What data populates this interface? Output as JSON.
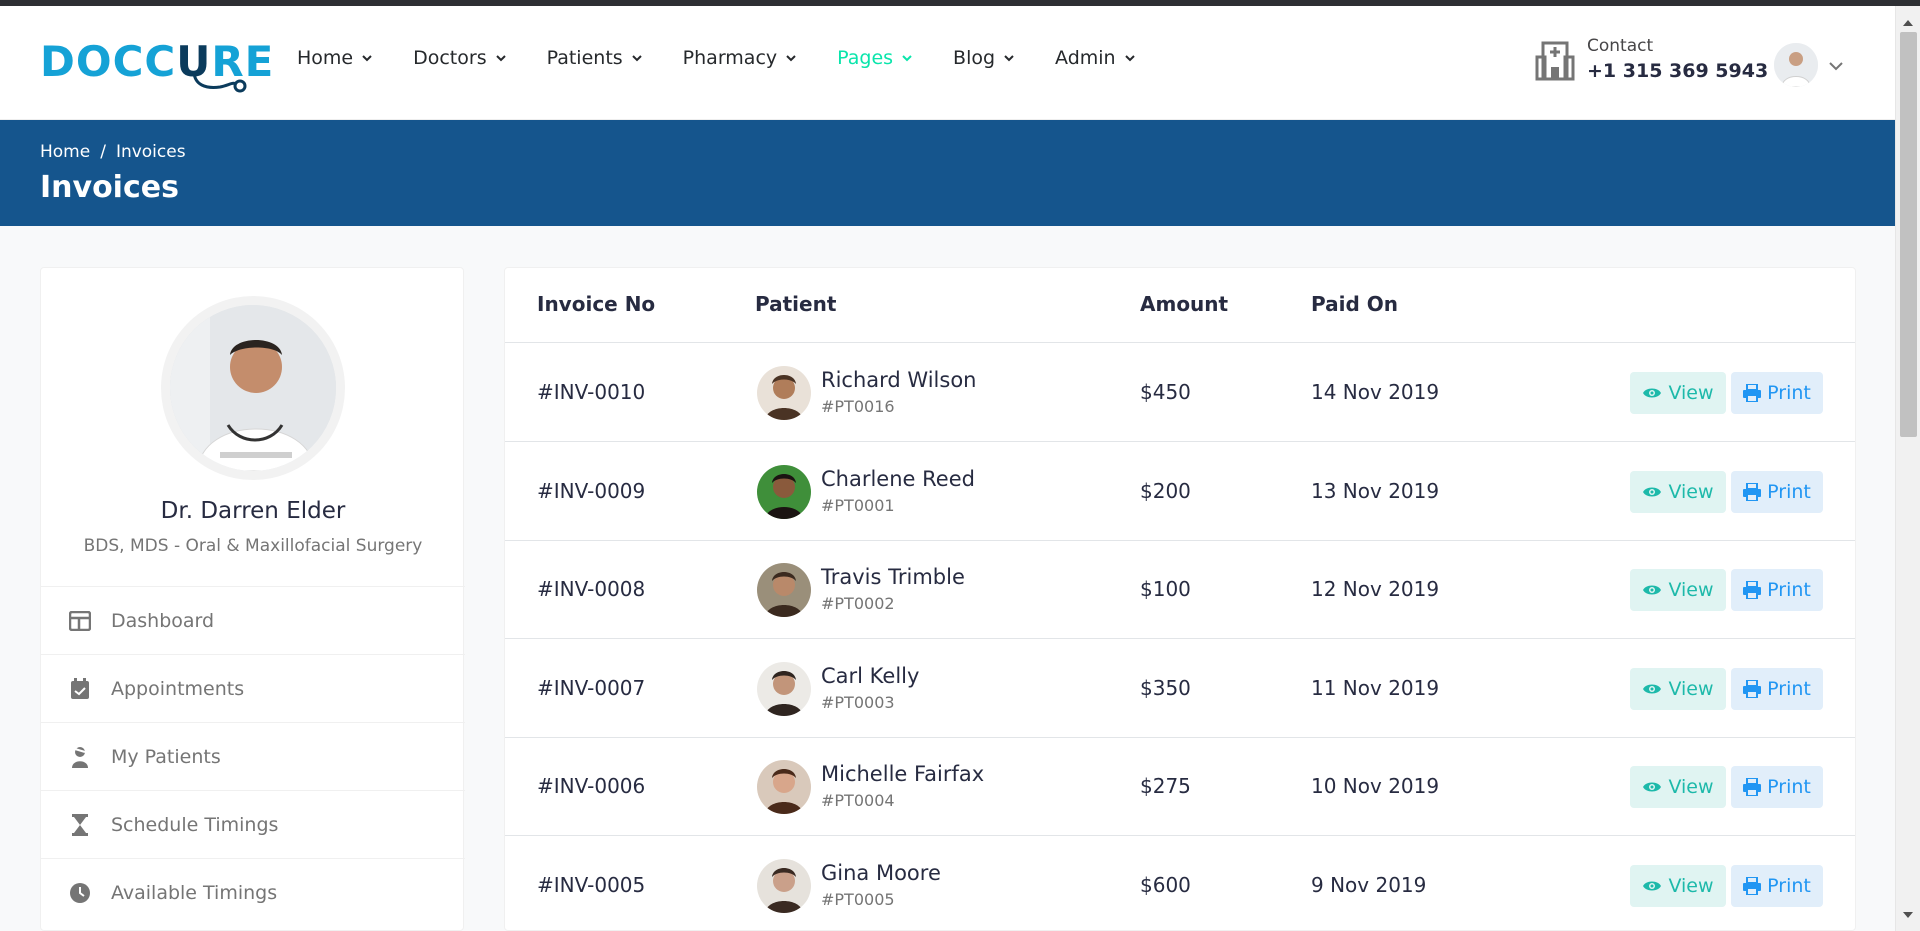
{
  "header": {
    "logo_text_a": "DOCC",
    "logo_text_u": "U",
    "logo_text_b": "RE",
    "nav": [
      {
        "label": "Home",
        "active": false
      },
      {
        "label": "Doctors",
        "active": false
      },
      {
        "label": "Patients",
        "active": false
      },
      {
        "label": "Pharmacy",
        "active": false
      },
      {
        "label": "Pages",
        "active": true
      },
      {
        "label": "Blog",
        "active": false
      },
      {
        "label": "Admin",
        "active": false
      }
    ],
    "contact_label": "Contact",
    "contact_phone": "+1 315 369 5943"
  },
  "breadcrumb": {
    "home": "Home",
    "separator": "/",
    "current": "Invoices",
    "title": "Invoices"
  },
  "sidebar": {
    "doctor_name": "Dr. Darren Elder",
    "doctor_specialty": "BDS, MDS - Oral & Maxillofacial Surgery",
    "menu": [
      {
        "label": "Dashboard",
        "icon": "dashboard-icon"
      },
      {
        "label": "Appointments",
        "icon": "calendar-check-icon"
      },
      {
        "label": "My Patients",
        "icon": "user-injured-icon"
      },
      {
        "label": "Schedule Timings",
        "icon": "hourglass-icon"
      },
      {
        "label": "Available Timings",
        "icon": "clock-icon"
      }
    ]
  },
  "table": {
    "headers": {
      "invoice": "Invoice No",
      "patient": "Patient",
      "amount": "Amount",
      "paid_on": "Paid On"
    },
    "view_label": "View",
    "print_label": "Print",
    "rows": [
      {
        "invoice": "#INV-0010",
        "patient": "Richard Wilson",
        "patient_id": "#PT0016",
        "amount": "$450",
        "paid_on": "14 Nov 2019"
      },
      {
        "invoice": "#INV-0009",
        "patient": "Charlene Reed",
        "patient_id": "#PT0001",
        "amount": "$200",
        "paid_on": "13 Nov 2019"
      },
      {
        "invoice": "#INV-0008",
        "patient": "Travis Trimble",
        "patient_id": "#PT0002",
        "amount": "$100",
        "paid_on": "12 Nov 2019"
      },
      {
        "invoice": "#INV-0007",
        "patient": "Carl Kelly",
        "patient_id": "#PT0003",
        "amount": "$350",
        "paid_on": "11 Nov 2019"
      },
      {
        "invoice": "#INV-0006",
        "patient": "Michelle Fairfax",
        "patient_id": "#PT0004",
        "amount": "$275",
        "paid_on": "10 Nov 2019"
      },
      {
        "invoice": "#INV-0005",
        "patient": "Gina Moore",
        "patient_id": "#PT0005",
        "amount": "$600",
        "paid_on": "9 Nov 2019"
      }
    ]
  },
  "colors": {
    "brand_blue": "#15558d",
    "accent_green": "#09e5ab",
    "view_text": "#1db9aa",
    "print_text": "#2196f3"
  }
}
